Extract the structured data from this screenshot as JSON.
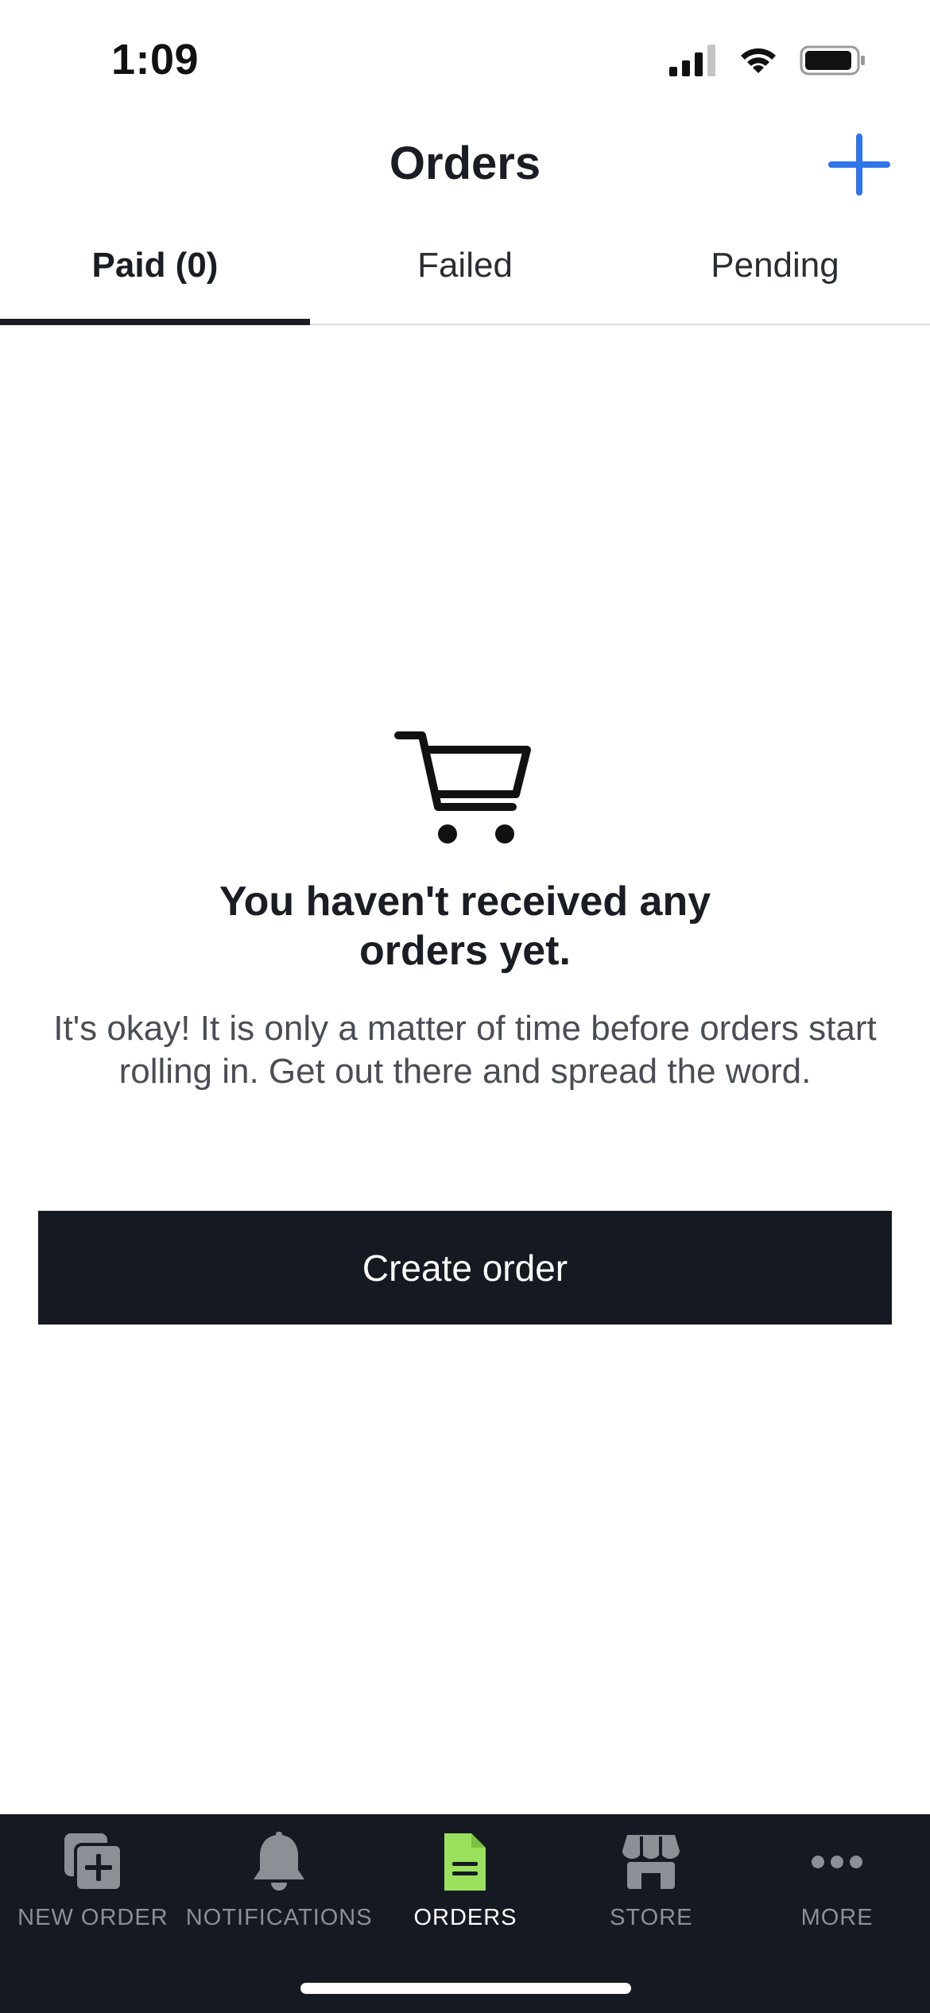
{
  "status_bar": {
    "time": "1:09"
  },
  "header": {
    "title": "Orders",
    "add_icon": "plus-icon"
  },
  "tabs": [
    {
      "label": "Paid (0)",
      "active": true
    },
    {
      "label": "Failed",
      "active": false
    },
    {
      "label": "Pending",
      "active": false
    }
  ],
  "empty_state": {
    "icon": "cart-icon",
    "title": "You haven't received any orders yet.",
    "description": "It's okay! It is only a matter of time before orders start rolling in. Get out there and spread the word.",
    "button_label": "Create order"
  },
  "bottom_nav": {
    "items": [
      {
        "label": "NEW ORDER",
        "icon": "new-order-icon",
        "active": false
      },
      {
        "label": "NOTIFICATIONS",
        "icon": "bell-icon",
        "active": false
      },
      {
        "label": "ORDERS",
        "icon": "document-icon",
        "active": true
      },
      {
        "label": "STORE",
        "icon": "store-icon",
        "active": false
      },
      {
        "label": "MORE",
        "icon": "more-icon",
        "active": false
      }
    ]
  },
  "colors": {
    "accent_blue": "#2f74e8",
    "dark": "#151a22",
    "active_tab_icon": "#9be15d",
    "inactive_icon": "#8c8f96"
  }
}
